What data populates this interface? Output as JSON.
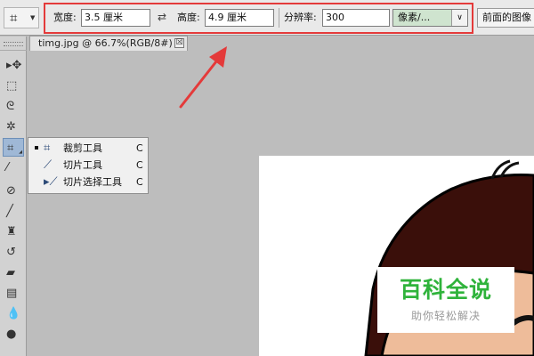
{
  "options_bar": {
    "width_label": "宽度:",
    "width_value": "3.5 厘米",
    "height_label": "高度:",
    "height_value": "4.9 厘米",
    "resolution_label": "分辨率:",
    "resolution_value": "300",
    "unit_value": "像素/...",
    "front_image_label": "前面的图像",
    "highlight_color": "#e43a3a"
  },
  "document_tab": {
    "title": "timg.jpg @ 66.7%(RGB/8#)",
    "close": "☒"
  },
  "flyout": {
    "items": [
      {
        "label": "裁剪工具",
        "key": "C",
        "selected": true,
        "icon": "crop-icon"
      },
      {
        "label": "切片工具",
        "key": "C",
        "selected": false,
        "icon": "slice-icon"
      },
      {
        "label": "切片选择工具",
        "key": "C",
        "selected": false,
        "icon": "slice-select-icon"
      }
    ]
  },
  "toolbox": {
    "tools": [
      "move-icon",
      "marquee-icon",
      "lasso-icon",
      "magic-wand-icon",
      "crop-icon",
      "eyedropper-icon",
      "healing-brush-icon",
      "brush-icon",
      "clone-stamp-icon",
      "history-brush-icon",
      "eraser-icon",
      "gradient-icon",
      "blur-icon",
      "dodge-icon"
    ],
    "active": "crop-icon"
  },
  "watermark": {
    "title": "百科全说",
    "subtitle": "助你轻松解决"
  },
  "colors": {
    "arrow": "#e43a3a",
    "hair": "#3a0f0a",
    "skin": "#eebc9a",
    "watermark_green": "#2fb33b"
  }
}
